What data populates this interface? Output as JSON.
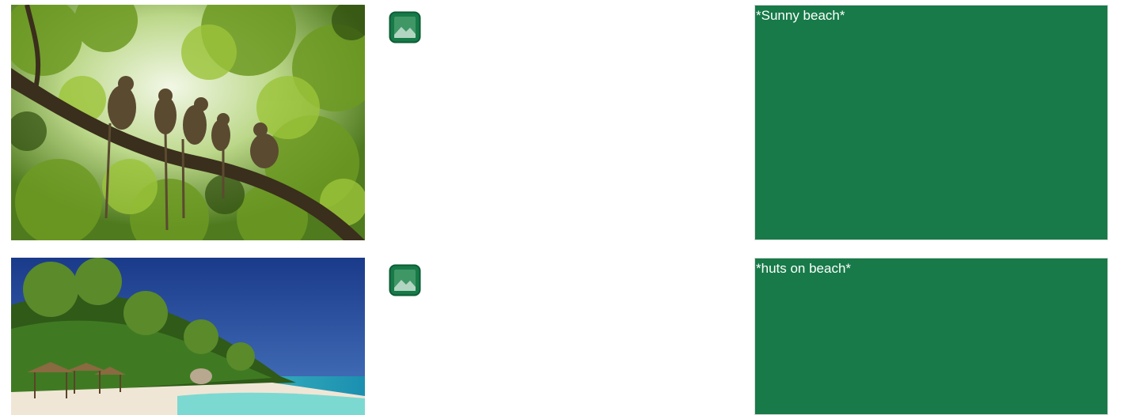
{
  "items": [
    {
      "alt_text": "*Sunny beach*",
      "icon": "image-icon",
      "photo_subject": "monkeys sitting on a tree branch"
    },
    {
      "alt_text": "*huts on beach*",
      "icon": "image-icon",
      "photo_subject": "tropical beach with thatched huts"
    }
  ],
  "colors": {
    "alt_panel_bg": "#177a48",
    "alt_panel_text": "#ffffff",
    "icon_fill": "#177a48"
  }
}
